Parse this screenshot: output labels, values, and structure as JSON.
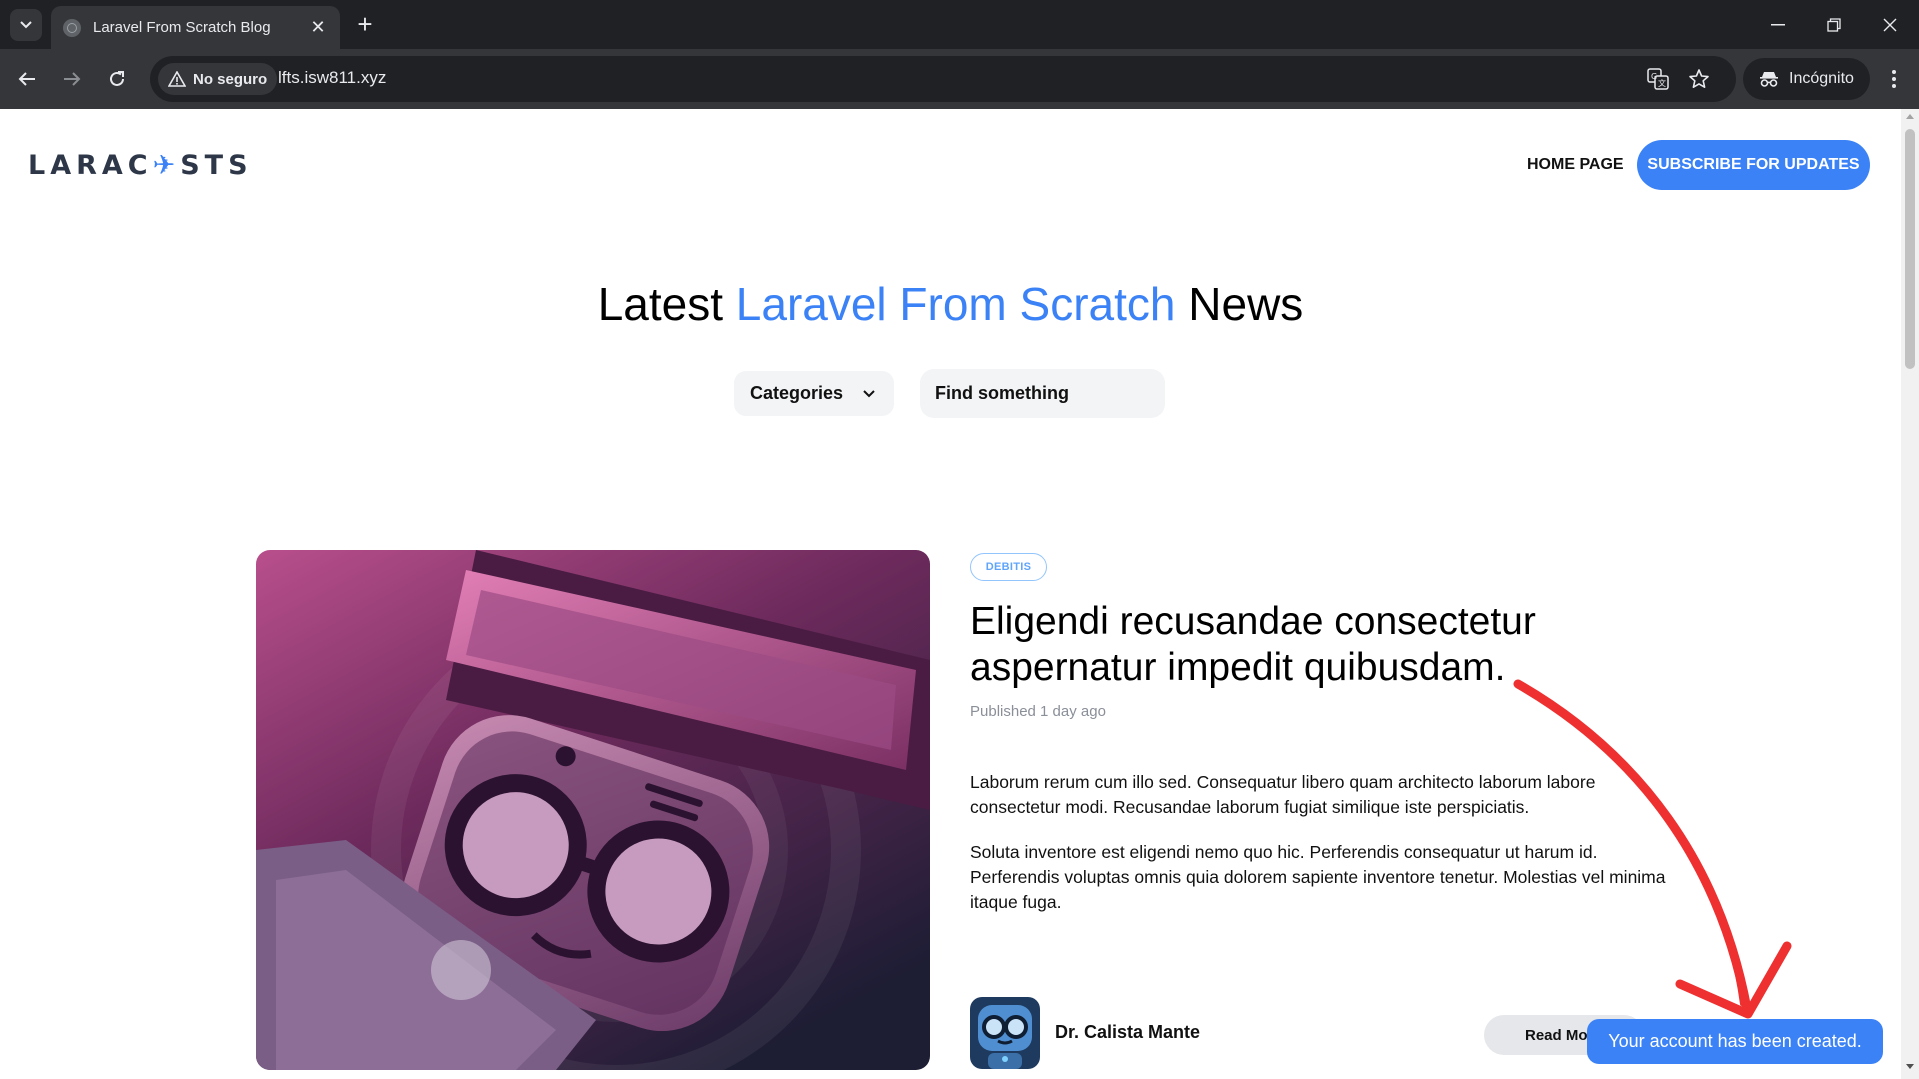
{
  "browser": {
    "tab_title": "Laravel From Scratch Blog",
    "security_label": "No seguro",
    "url": "lfts.isw811.xyz",
    "profile_label": "Incógnito"
  },
  "site": {
    "logo_text_a": "LARAC",
    "logo_text_b": "STS",
    "nav_home": "HOME PAGE",
    "subscribe_label": "SUBSCRIBE FOR UPDATES"
  },
  "hero": {
    "title_pre": "Latest",
    "title_accent": "Laravel From Scratch",
    "title_post": "News",
    "accent_color": "#3b82f6"
  },
  "filters": {
    "categories_label": "Categories",
    "search_placeholder": "Find something"
  },
  "post": {
    "category": "DEBITIS",
    "title": "Eligendi recusandae consectetur aspernatur impedit quibusdam.",
    "published": "Published 1 day ago",
    "excerpt_1": "Laborum rerum cum illo sed. Consequatur libero quam architecto laborum labore consectetur modi. Recusandae laborum fugiat similique iste perspiciatis.",
    "excerpt_2": "Soluta inventore est eligendi nemo quo hic. Perferendis consequatur ut harum id. Perferendis voluptas omnis quia dolorem sapiente inventore tenetur. Molestias vel minima itaque fuga.",
    "author": "Dr. Calista Mante",
    "read_more": "Read More"
  },
  "toast": {
    "message": "Your account has been created."
  }
}
